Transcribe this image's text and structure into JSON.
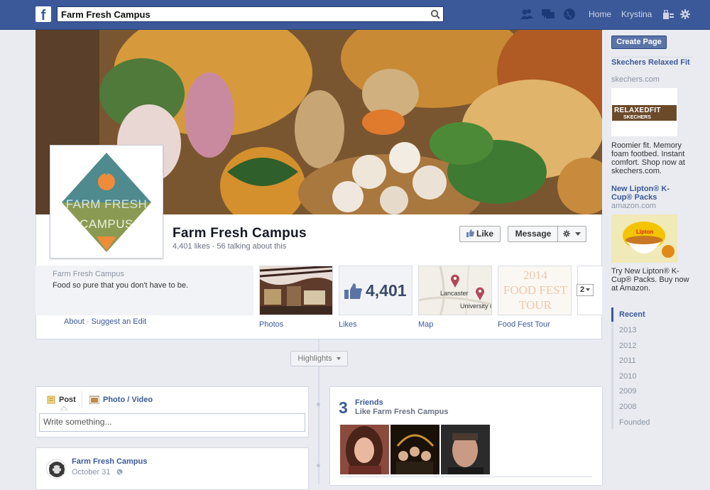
{
  "topbar": {
    "logo": "f",
    "search_value": "Farm Fresh Campus",
    "nav": [
      "Home",
      "Krystina"
    ]
  },
  "page": {
    "title": "Farm Fresh Campus",
    "stats": "4,401 likes · 56 talking about this",
    "logo_line1": "FARM FRESH",
    "logo_line2": "CAMPUS"
  },
  "actions": {
    "like": "Like",
    "message": "Message"
  },
  "about": {
    "name": "Farm Fresh Campus",
    "description": "Food so pure that you don't have to be.",
    "about_link": "About",
    "separator": " · ",
    "suggest_link": "Suggest an Edit"
  },
  "apps": {
    "photos_label": "Photos",
    "likes_label": "Likes",
    "likes_count": "4,401",
    "map_label": "Map",
    "map_city": "Lancaster",
    "map_place": "University c",
    "foodfest_label": "Food Fest Tour",
    "foodfest_l1": "2014",
    "foodfest_l2": "FOOD FEST",
    "foodfest_l3": "TOUR",
    "more_count": "2"
  },
  "highlights": "Highlights",
  "composer": {
    "post_tab": "Post",
    "photo_tab": "Photo / Video",
    "placeholder": "Write something..."
  },
  "post": {
    "author": "Farm Fresh Campus",
    "date": "October 31"
  },
  "friends": {
    "count": "3",
    "title": "Friends",
    "subtitle": "Like Farm Fresh Campus"
  },
  "sidebar": {
    "create_page": "Create Page",
    "ads": [
      {
        "title": "Skechers Relaxed Fit",
        "domain": "skechers.com",
        "image_text_1": "RELAXEDFIT",
        "image_text_2": "SKECHERS",
        "body": "Roomier fit. Memory foam footbed. Instant comfort. Shop now at skechers.com."
      },
      {
        "title": "New Lipton® K-Cup® Packs",
        "domain": "amazon.com",
        "image_text_1": "Lipton",
        "body": "Try New Lipton® K-Cup® Packs. Buy now at Amazon."
      }
    ],
    "years": [
      "Recent",
      "2013",
      "2012",
      "2011",
      "2010",
      "2009",
      "2008",
      "Founded"
    ]
  },
  "colors": {
    "brand": "#3b5998",
    "logo_teal": "#4f8a8f",
    "logo_olive": "#8a9a52",
    "logo_orange": "#f08b3a"
  }
}
